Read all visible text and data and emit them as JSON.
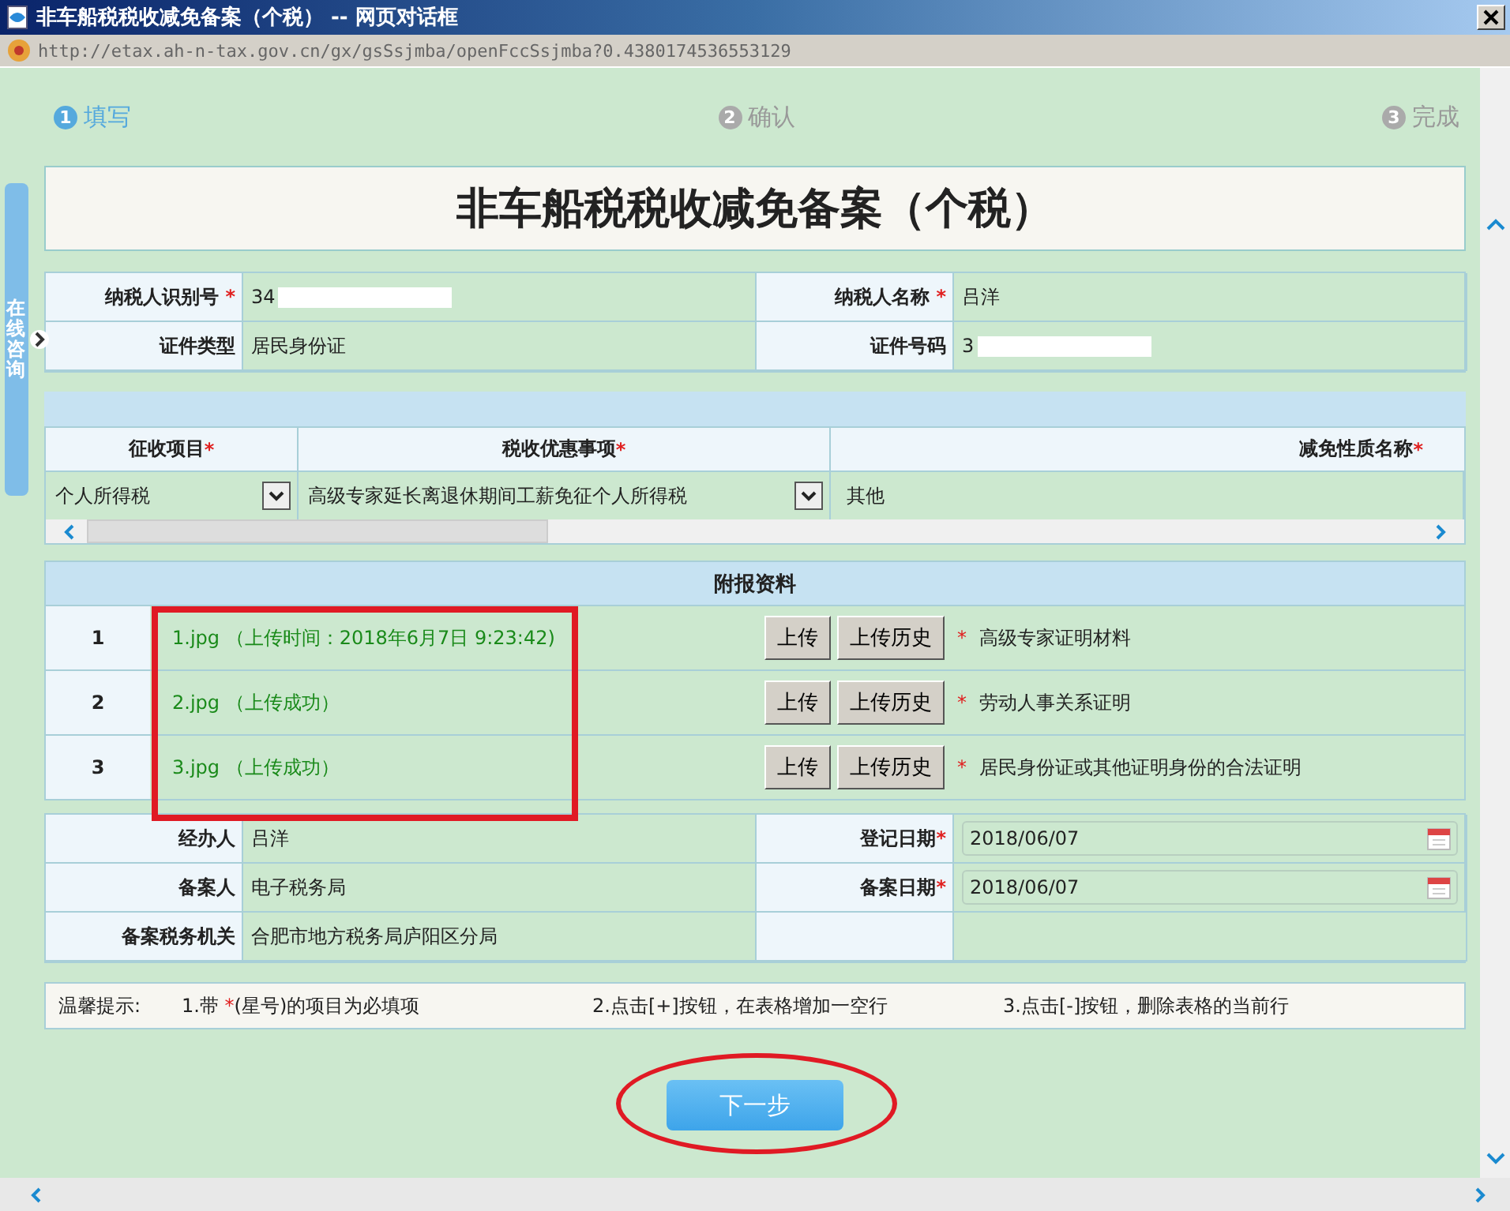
{
  "window": {
    "title": "非车船税税收减免备案（个税） -- 网页对话框",
    "address": "http://etax.ah-n-tax.gov.cn/gx/gsSsjmba/openFccSsjmba?0.4380174536553129"
  },
  "side_tab": "在线咨询",
  "steps": [
    {
      "number": "1",
      "label": "填写",
      "selected": true
    },
    {
      "number": "2",
      "label": "确认",
      "selected": false
    },
    {
      "number": "3",
      "label": "完成",
      "selected": false
    }
  ],
  "form_title": "非车船税税收减免备案（个税）",
  "taxpayer_rows": [
    [
      {
        "label": "纳税人识别号",
        "mark": "*",
        "value": "34",
        "redacted": true
      },
      {
        "label": "纳税人名称",
        "mark": "*",
        "value": "吕洋",
        "redacted": false
      }
    ],
    [
      {
        "label": "证件类型",
        "value": "居民身份证",
        "redacted": false
      },
      {
        "label": "证件号码",
        "value": "3",
        "redacted": true
      }
    ]
  ],
  "items_table": {
    "columns": [
      {
        "label": "征收项目",
        "mark": "*"
      },
      {
        "label": "税收优惠事项",
        "mark": "*"
      },
      {
        "label": "减免性质名称",
        "mark": "*"
      }
    ],
    "rows": [
      [
        {
          "kind": "select",
          "value": "个人所得税"
        },
        {
          "kind": "select",
          "value": "高级专家延长离退休期间工薪免征个人所得税"
        },
        {
          "kind": "text",
          "value": "其他"
        }
      ]
    ]
  },
  "attachments": {
    "title": "附报资料",
    "rows": [
      {
        "number": "1",
        "file": "1.jpg （上传时间：2018年6月7日 9:23:42)",
        "upload": "上传",
        "history": "上传历史",
        "mark": "*",
        "description": "高级专家证明材料"
      },
      {
        "number": "2",
        "file": "2.jpg （上传成功）",
        "upload": "上传",
        "history": "上传历史",
        "mark": "*",
        "description": "劳动人事关系证明"
      },
      {
        "number": "3",
        "file": "3.jpg （上传成功）",
        "upload": "上传",
        "history": "上传历史",
        "mark": "*",
        "description": "居民身份证或其他证明身份的合法证明"
      }
    ]
  },
  "filing_rows": [
    [
      {
        "label": "经办人",
        "kind": "text",
        "value": "吕洋"
      },
      {
        "label": "登记日期",
        "mark": "*",
        "kind": "date",
        "value": "2018/06/07"
      }
    ],
    [
      {
        "label": "备案人",
        "kind": "text",
        "value": "电子税务局"
      },
      {
        "label": "备案日期",
        "mark": "*",
        "kind": "date",
        "value": "2018/06/07"
      }
    ],
    [
      {
        "label": "备案税务机关",
        "kind": "text",
        "value": "合肥市地方税务局庐阳区分局"
      },
      {
        "kind": "empty"
      }
    ]
  ],
  "tips": {
    "label": "温馨提示:",
    "items": [
      {
        "before": "1.带 ",
        "mark": "*",
        "after": "(星号)的项目为必填项"
      },
      {
        "before": "2.点击[+]按钮，在表格增加一空行"
      },
      {
        "before": "3.点击[-]按钮，删除表格的当前行"
      }
    ]
  },
  "next_button": "下一步"
}
